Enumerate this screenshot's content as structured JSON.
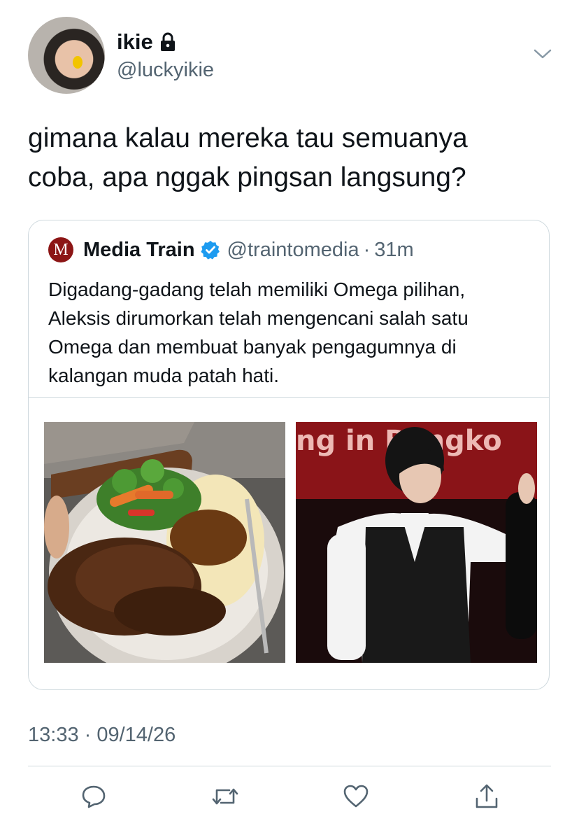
{
  "author": {
    "display_name": "ikie",
    "handle": "@luckyikie",
    "protected_icon": "lock-icon",
    "avatar": "profile-photo"
  },
  "menu_icon": "chevron-down-icon",
  "tweet": {
    "text": "gimana kalau mereka tau semuanya\ncoba, apa nggak pingsan langsung?",
    "timestamp": "13:33 · 09/14/26"
  },
  "quoted_tweet": {
    "logo_letter": "M",
    "name": "Media Train",
    "verified_icon": "verified-badge-icon",
    "handle": "@traintomedia",
    "separator": "·",
    "time": "31m",
    "text": "Digadang-gadang telah memiliki Omega pilihan, Aleksis dirumorkan telah mengencani salah satu Omega dan membuat banyak pengagumnya di kalangan muda patah hati.",
    "photo_left": "plate of braised meat with mashed potatoes, gravy and vegetables",
    "photo_right": "young man in white shirt and black vest on stage",
    "photo_right_banner_text": "ng in Bangko"
  },
  "actions": [
    "reply-icon",
    "retweet-icon",
    "like-icon",
    "share-icon"
  ],
  "colors": {
    "text": "#0f1419",
    "secondary": "#536471",
    "border": "#cfd9de",
    "verified": "#1d9bf0",
    "logo": "#8c1515"
  }
}
